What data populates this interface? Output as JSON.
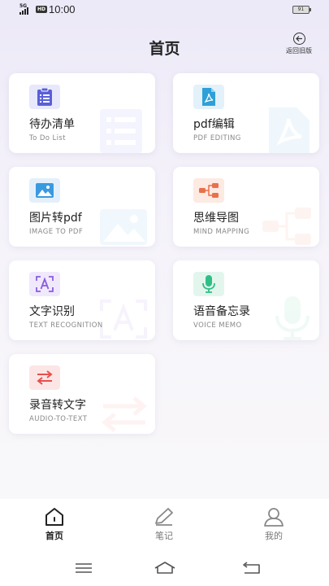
{
  "status_bar": {
    "signal": "5G",
    "hd": "HD",
    "time": "10:00",
    "battery": "91"
  },
  "header": {
    "title": "首页",
    "back_label": "返回旧版"
  },
  "cards": [
    {
      "title": "待办清单",
      "subtitle": "To Do List",
      "icon": "clipboard-list-icon",
      "color": "#5a5fd8"
    },
    {
      "title": "pdf编辑",
      "subtitle": "PDF EDITING",
      "icon": "pdf-file-icon",
      "color": "#2ea0d8"
    },
    {
      "title": "图片转pdf",
      "subtitle": "IMAGE TO PDF",
      "icon": "image-icon",
      "color": "#3a9ae0"
    },
    {
      "title": "思维导图",
      "subtitle": "MIND MAPPING",
      "icon": "mind-map-icon",
      "color": "#e8714a"
    },
    {
      "title": "文字识别",
      "subtitle": "TEXT RECOGNITION",
      "icon": "text-scan-icon",
      "color": "#8a5be0"
    },
    {
      "title": "语音备忘录",
      "subtitle": "VOICE MEMO",
      "icon": "microphone-icon",
      "color": "#2fbf86"
    },
    {
      "title": "录音转文字",
      "subtitle": "AUDIO-TO-TEXT",
      "icon": "swap-arrows-icon",
      "color": "#e6504e"
    }
  ],
  "tabbar": {
    "home": "首页",
    "notes": "笔记",
    "mine": "我的"
  }
}
